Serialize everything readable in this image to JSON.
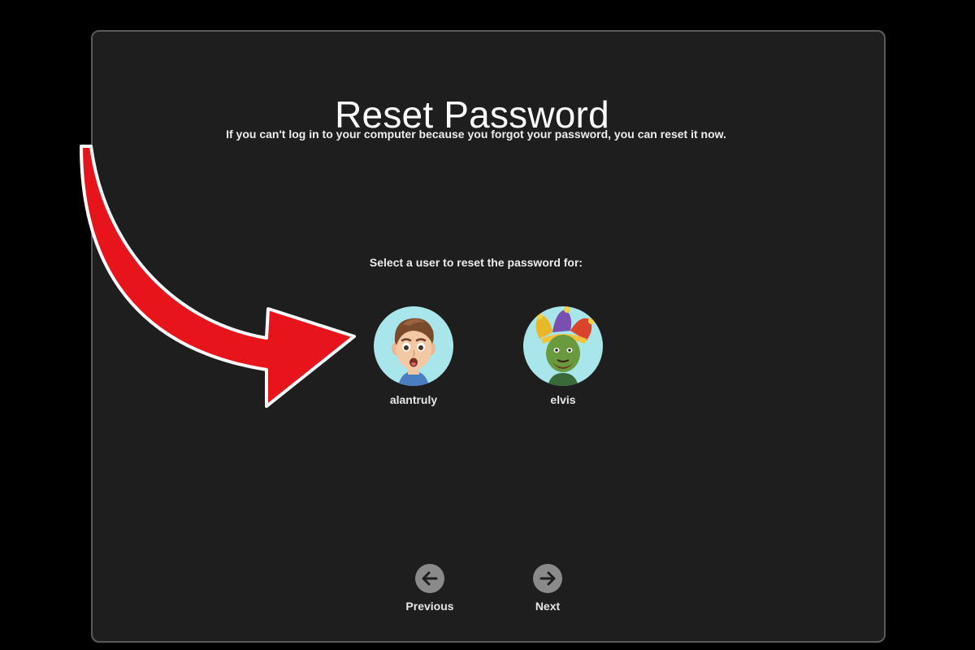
{
  "dialog": {
    "title": "Reset Password",
    "subtitle": "If you can't log in to your computer because you forgot your password, you can reset it now.",
    "prompt": "Select a user to reset the password for:"
  },
  "users": [
    {
      "name": "alantruly",
      "avatar_icon": "memoji-boy-icon",
      "avatar_bg": "#a9e6ec"
    },
    {
      "name": "elvis",
      "avatar_icon": "memoji-jester-icon",
      "avatar_bg": "#a9e6ec"
    }
  ],
  "navigation": {
    "previous_label": "Previous",
    "previous_icon": "arrow-left-icon",
    "next_label": "Next",
    "next_icon": "arrow-right-icon"
  },
  "annotation": {
    "arrow_icon": "red-curved-arrow-icon",
    "arrow_color": "#e8141b"
  },
  "colors": {
    "background": "#000000",
    "panel": "#1e1e1e",
    "panel_border": "#5a5a5a",
    "text": "#ffffff",
    "nav_circle": "#8a8a8a"
  }
}
